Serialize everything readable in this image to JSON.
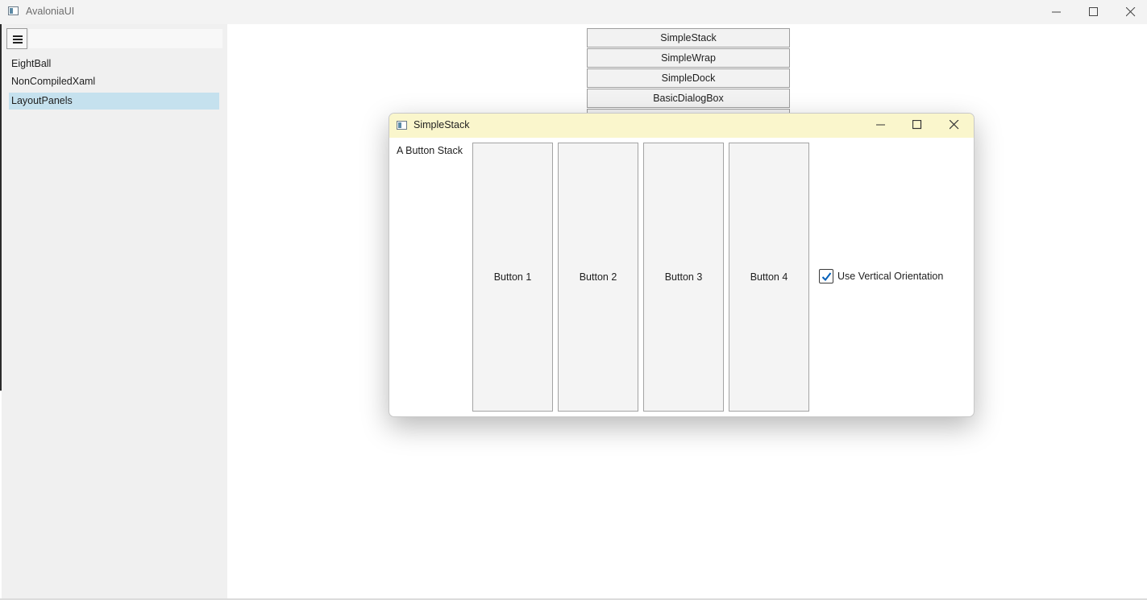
{
  "window": {
    "title": "AvaloniaUI",
    "icons": {
      "app": "app-window-icon",
      "minimize": "minimize-icon",
      "maximize": "maximize-icon",
      "close": "close-icon"
    }
  },
  "sidebar": {
    "menu_icon": "hamburger-menu-icon",
    "search_value": "",
    "items": [
      {
        "label": "EightBall",
        "selected": false
      },
      {
        "label": "NonCompiledXaml",
        "selected": false
      },
      {
        "label": "LayoutPanels",
        "selected": true
      }
    ],
    "selected_color": "#c5e1ee"
  },
  "content": {
    "panel_buttons": [
      "SimpleStack",
      "SimpleWrap",
      "SimpleDock",
      "BasicDialogBox"
    ]
  },
  "dialog": {
    "title": "SimpleStack",
    "titlebar_color": "#faf6cc",
    "label": "A Button Stack",
    "buttons": [
      "Button 1",
      "Button 2",
      "Button 3",
      "Button 4"
    ],
    "checkbox": {
      "label": "Use Vertical Orientation",
      "checked": true,
      "check_color": "#005fb8"
    }
  }
}
